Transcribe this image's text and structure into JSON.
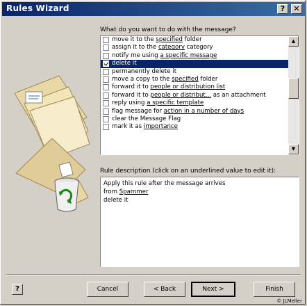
{
  "window": {
    "title": "Rules Wizard",
    "help_glyph": "?",
    "close_glyph": "✕"
  },
  "question": "What do you want to do with the message?",
  "actions": [
    {
      "checked": false,
      "selected": false,
      "pre": "move it to the ",
      "link": "specified",
      "post": " folder"
    },
    {
      "checked": false,
      "selected": false,
      "pre": "assign it to the ",
      "link": "category",
      "post": " category"
    },
    {
      "checked": false,
      "selected": false,
      "pre": "notify me using ",
      "link": "a specific message",
      "post": ""
    },
    {
      "checked": true,
      "selected": true,
      "pre": "delete it",
      "link": "",
      "post": ""
    },
    {
      "checked": false,
      "selected": false,
      "pre": "permanently delete it",
      "link": "",
      "post": ""
    },
    {
      "checked": false,
      "selected": false,
      "pre": "move a copy to the ",
      "link": "specified",
      "post": " folder"
    },
    {
      "checked": false,
      "selected": false,
      "pre": "forward it to ",
      "link": "people or distribution list",
      "post": ""
    },
    {
      "checked": false,
      "selected": false,
      "pre": "forward it to ",
      "link": "people or distribut...",
      "post": " as an attachment"
    },
    {
      "checked": false,
      "selected": false,
      "pre": "reply using ",
      "link": "a specific template",
      "post": ""
    },
    {
      "checked": false,
      "selected": false,
      "pre": "flag message for ",
      "link": "action in a number of days",
      "post": ""
    },
    {
      "checked": false,
      "selected": false,
      "pre": "clear the Message Flag",
      "link": "",
      "post": ""
    },
    {
      "checked": false,
      "selected": false,
      "pre": "mark it as ",
      "link": "importance",
      "post": ""
    }
  ],
  "scroll": {
    "up_glyph": "▲",
    "down_glyph": "▼"
  },
  "description_label": "Rule description (click on an underlined value to edit it):",
  "description_lines": [
    {
      "pre": "Apply this rule after the message arrives",
      "link": ""
    },
    {
      "pre": "from ",
      "link": "Spammer"
    },
    {
      "pre": "delete it",
      "link": ""
    }
  ],
  "buttons": {
    "help": "?",
    "cancel": "Cancel",
    "back": "< Back",
    "next": "Next >",
    "finish": "Finish"
  },
  "credit": "© JLMeller"
}
